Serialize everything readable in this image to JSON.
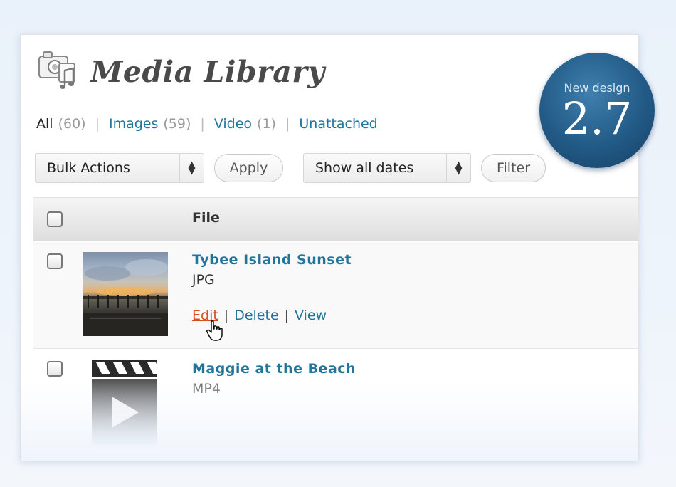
{
  "page": {
    "title": "Media Library",
    "icon": "media-library-icon"
  },
  "filters": {
    "all_label": "All",
    "all_count": "(60)",
    "images_label": "Images",
    "images_count": "(59)",
    "video_label": "Video",
    "video_count": "(1)",
    "unattached_label": "Unattached",
    "separator": "|"
  },
  "toolbar": {
    "bulk_actions": "Bulk Actions",
    "apply_label": "Apply",
    "dates": "Show all dates",
    "filter_label": "Filter"
  },
  "table": {
    "column_file": "File",
    "rows": [
      {
        "title": "Tybee Island Sunset",
        "type": "JPG",
        "thumbnail": "sunset-photo-thumbnail",
        "actions": [
          "Edit",
          "Delete",
          "View"
        ]
      },
      {
        "title": "Maggie at the Beach",
        "type": "MP4",
        "thumbnail": "video-clapperboard-icon"
      }
    ]
  },
  "badge": {
    "caption": "New design",
    "version": "2.7"
  },
  "colors": {
    "link": "#21759b",
    "edit_hover": "#d54e21",
    "badge": "#225a86"
  }
}
